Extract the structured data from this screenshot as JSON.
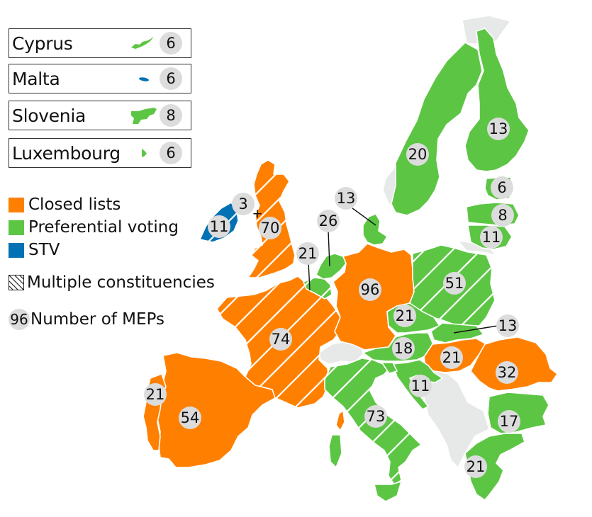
{
  "colors": {
    "closed_lists": "#ff8000",
    "preferential_voting": "#5cc644",
    "stv": "#0071b3",
    "non_eu": "#e7e8e8",
    "badge": "#dcdcdc"
  },
  "insets": [
    {
      "name": "Cyprus",
      "system": "preferential_voting",
      "meps": "6"
    },
    {
      "name": "Malta",
      "system": "stv",
      "meps": "6"
    },
    {
      "name": "Slovenia",
      "system": "preferential_voting",
      "meps": "8"
    },
    {
      "name": "Luxembourg",
      "system": "preferential_voting",
      "meps": "6"
    }
  ],
  "legend": {
    "closed_lists": "Closed lists",
    "preferential_voting": "Preferential voting",
    "stv": "STV",
    "multiple_constituencies": "Multiple constituencies",
    "number_sample": "96",
    "number_of_meps": "Number of MEPs"
  },
  "countries": [
    {
      "name": "Ireland",
      "system": "stv",
      "multiple_constituencies": true,
      "meps": "11"
    },
    {
      "name": "Northern Ireland (UK)",
      "system": "stv",
      "multiple_constituencies": false,
      "meps": "3"
    },
    {
      "name": "United Kingdom (Great Britain)",
      "system": "closed_lists",
      "multiple_constituencies": true,
      "meps": "70"
    },
    {
      "name": "Portugal",
      "system": "closed_lists",
      "multiple_constituencies": false,
      "meps": "21"
    },
    {
      "name": "Spain",
      "system": "closed_lists",
      "multiple_constituencies": false,
      "meps": "54"
    },
    {
      "name": "France",
      "system": "closed_lists",
      "multiple_constituencies": true,
      "meps": "74"
    },
    {
      "name": "Belgium",
      "system": "preferential_voting",
      "multiple_constituencies": true,
      "meps": "21"
    },
    {
      "name": "Netherlands",
      "system": "preferential_voting",
      "multiple_constituencies": false,
      "meps": "26"
    },
    {
      "name": "Denmark",
      "system": "preferential_voting",
      "multiple_constituencies": false,
      "meps": "13"
    },
    {
      "name": "Germany",
      "system": "closed_lists",
      "multiple_constituencies": false,
      "meps": "96"
    },
    {
      "name": "Sweden",
      "system": "preferential_voting",
      "multiple_constituencies": false,
      "meps": "20"
    },
    {
      "name": "Finland",
      "system": "preferential_voting",
      "multiple_constituencies": false,
      "meps": "13"
    },
    {
      "name": "Estonia",
      "system": "preferential_voting",
      "multiple_constituencies": false,
      "meps": "6"
    },
    {
      "name": "Latvia",
      "system": "preferential_voting",
      "multiple_constituencies": false,
      "meps": "8"
    },
    {
      "name": "Lithuania",
      "system": "preferential_voting",
      "multiple_constituencies": false,
      "meps": "11"
    },
    {
      "name": "Poland",
      "system": "preferential_voting",
      "multiple_constituencies": true,
      "meps": "51"
    },
    {
      "name": "Czech Republic",
      "system": "preferential_voting",
      "multiple_constituencies": false,
      "meps": "21"
    },
    {
      "name": "Slovakia",
      "system": "preferential_voting",
      "multiple_constituencies": false,
      "meps": "13"
    },
    {
      "name": "Austria",
      "system": "preferential_voting",
      "multiple_constituencies": false,
      "meps": "18"
    },
    {
      "name": "Hungary",
      "system": "closed_lists",
      "multiple_constituencies": false,
      "meps": "21"
    },
    {
      "name": "Romania",
      "system": "closed_lists",
      "multiple_constituencies": false,
      "meps": "32"
    },
    {
      "name": "Croatia",
      "system": "preferential_voting",
      "multiple_constituencies": false,
      "meps": "11"
    },
    {
      "name": "Italy",
      "system": "preferential_voting",
      "multiple_constituencies": true,
      "meps": "73"
    },
    {
      "name": "Bulgaria",
      "system": "preferential_voting",
      "multiple_constituencies": false,
      "meps": "17"
    },
    {
      "name": "Greece",
      "system": "preferential_voting",
      "multiple_constituencies": false,
      "meps": "21"
    }
  ],
  "plus_sign": "+"
}
